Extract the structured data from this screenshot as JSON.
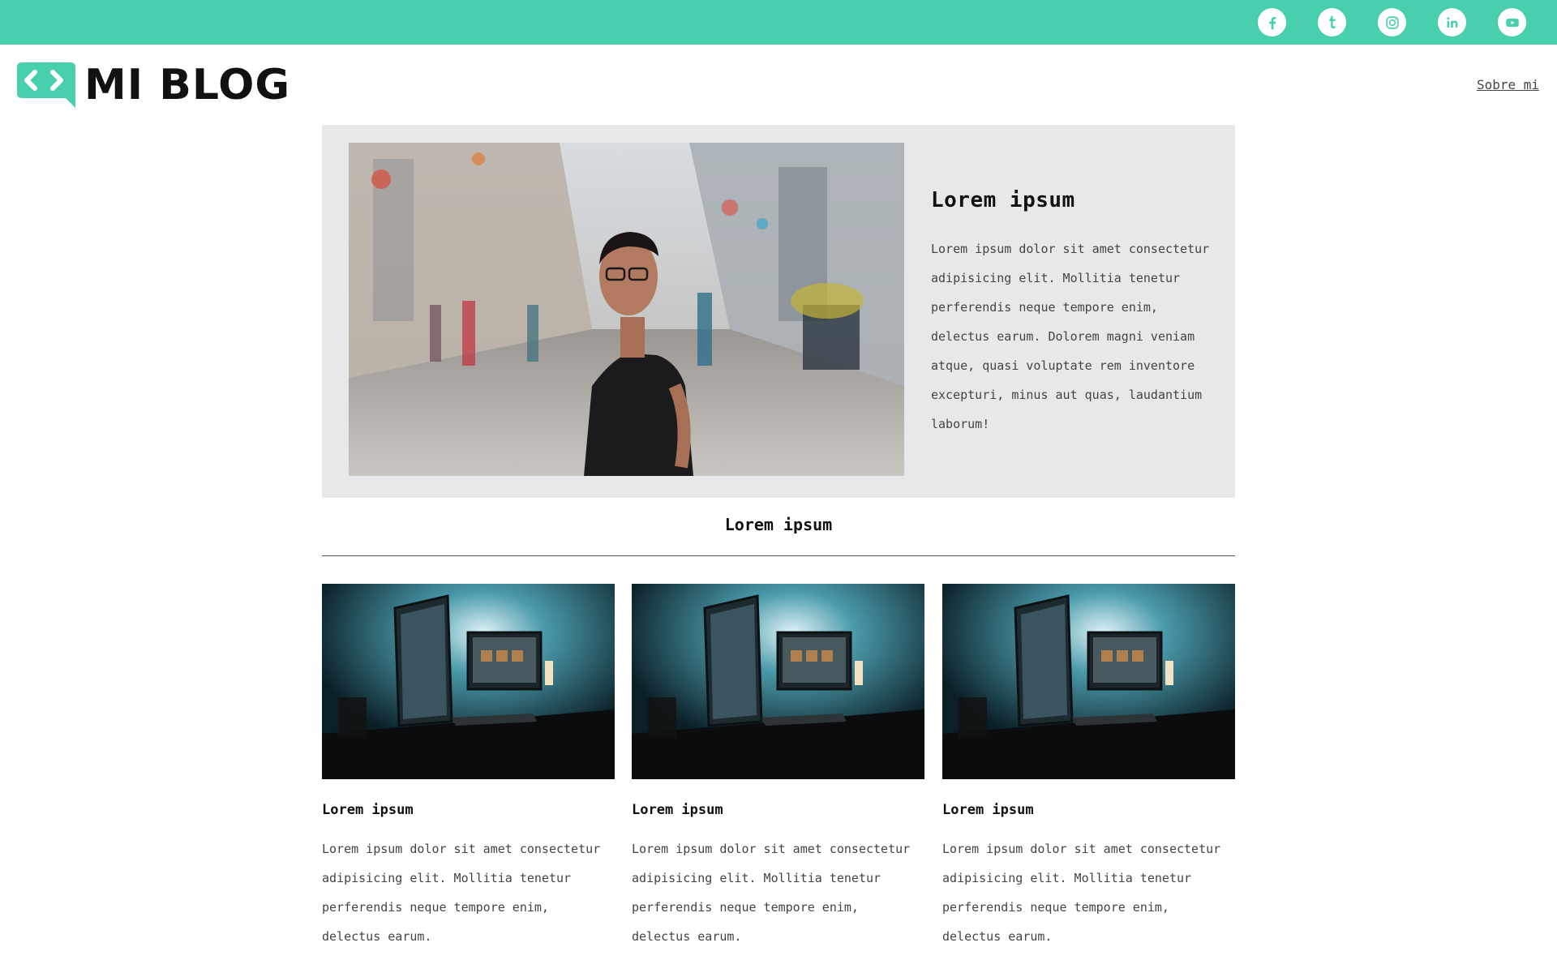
{
  "colors": {
    "accent": "#48cfad",
    "hero_bg": "#e6e8ea",
    "text_dark": "#111111",
    "text_muted": "#444444"
  },
  "topbar": {
    "social_icons": [
      "facebook-icon",
      "tumblr-icon",
      "instagram-icon",
      "linkedin-icon",
      "youtube-icon"
    ]
  },
  "header": {
    "logo_text": "MI BLOG",
    "nav_link": "Sobre mi"
  },
  "hero": {
    "title": "Lorem ipsum",
    "text": "Lorem ipsum dolor sit amet consectetur adipisicing elit. Mollitia tenetur perferendis neque tempore enim, delectus earum. Dolorem magni veniam atque, quasi voluptate rem inventore excepturi, minus aut quas, laudantium laborum!"
  },
  "section": {
    "title": "Lorem ipsum"
  },
  "cards": [
    {
      "title": "Lorem ipsum",
      "text": "Lorem ipsum dolor sit amet consectetur adipisicing elit. Mollitia tenetur perferendis neque tempore enim, delectus earum."
    },
    {
      "title": "Lorem ipsum",
      "text": "Lorem ipsum dolor sit amet consectetur adipisicing elit. Mollitia tenetur perferendis neque tempore enim, delectus earum."
    },
    {
      "title": "Lorem ipsum",
      "text": "Lorem ipsum dolor sit amet consectetur adipisicing elit. Mollitia tenetur perferendis neque tempore enim, delectus earum."
    }
  ]
}
